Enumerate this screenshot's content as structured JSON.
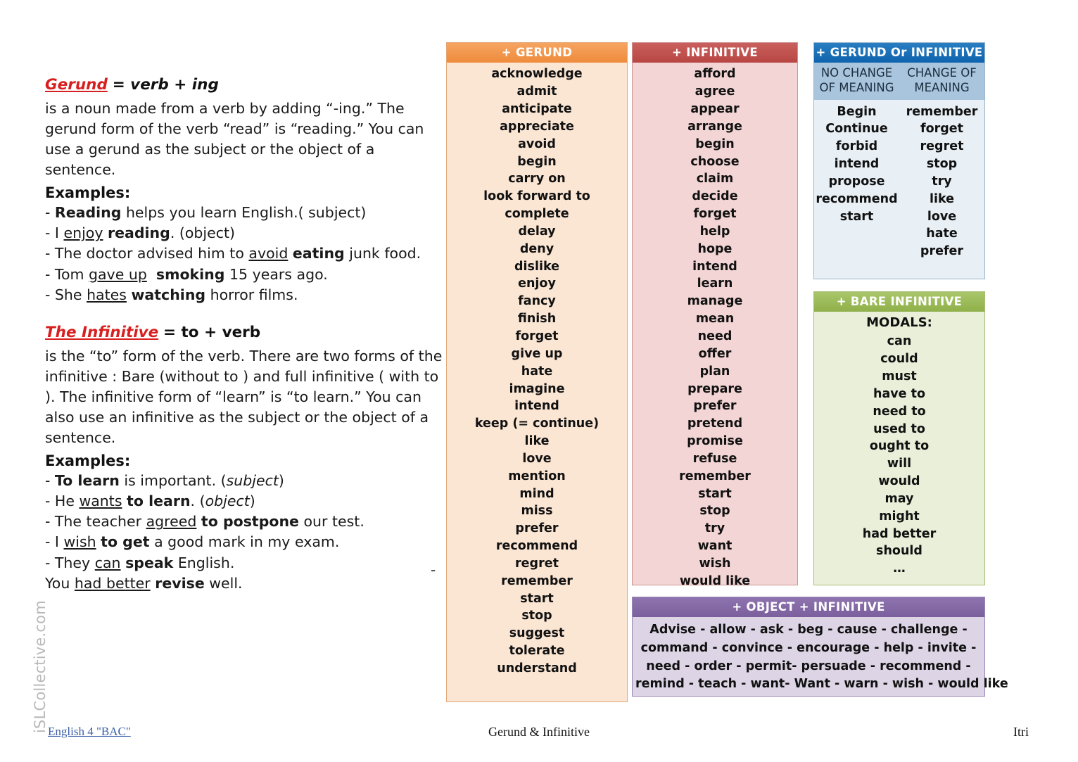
{
  "left": {
    "gerund": {
      "title_kw": "Gerund",
      "title_rest": "= verb + ing",
      "paragraph": "is a noun made from a verb by adding “-ing.” The gerund form of the verb “read” is “reading.” You can use a gerund as the subject or the object of a sentence.",
      "examples_label": "Examples:",
      "examples": [
        "- Reading helps you learn English.( subject)",
        "- I enjoy reading. (object)",
        "- The doctor advised him to avoid eating junk food.",
        "- Tom gave up smoking 15 years ago.",
        "- She hates watching horror films."
      ]
    },
    "infinitive": {
      "title_kw": "The Infinitive",
      "title_rest": "=  to + verb",
      "paragraph": "is the “to” form of the verb. There are two forms of the infinitive : Bare (without to ) and full infinitive ( with to ). The infinitive form of “learn” is “to learn.” You can also use an infinitive as the subject or the object of a sentence.",
      "examples_label": "Examples:",
      "examples": [
        "- To learn is important. (subject)",
        "- He wants to learn. (object)",
        "- The teacher agreed to postpone our test.",
        "- I wish to get a good mark in my exam.",
        "- They can speak English.",
        "You had better revise well."
      ]
    },
    "stray_dash": "-"
  },
  "watermark": "iSLCollective.com",
  "panels": {
    "gerund": {
      "header": "+ GERUND",
      "header_color": "#ef8b3c",
      "body_color": "#fbe6d4",
      "words": [
        "acknowledge",
        "admit",
        "anticipate",
        "appreciate",
        "avoid",
        "begin",
        "carry on",
        "look forward to",
        "complete",
        "delay",
        "deny",
        "dislike",
        "enjoy",
        "fancy",
        "finish",
        "forget",
        "give up",
        "hate",
        "imagine",
        "intend",
        "keep (= continue)",
        "like",
        "love",
        "mention",
        "mind",
        "miss",
        "prefer",
        "recommend",
        "regret",
        "remember",
        "start",
        "stop",
        "suggest",
        "tolerate",
        "understand"
      ]
    },
    "infinitive": {
      "header": "+ INFINITIVE",
      "header_color": "#b84643",
      "body_color": "#f2d5d4",
      "words": [
        "afford",
        "agree",
        "appear",
        "arrange",
        "begin",
        "choose",
        "claim",
        "decide",
        "forget",
        "help",
        "hope",
        "intend",
        "learn",
        "manage",
        "mean",
        "need",
        "offer",
        "plan",
        "prepare",
        "prefer",
        "pretend",
        "promise",
        "refuse",
        "remember",
        "start",
        "stop",
        "try",
        "want",
        "wish",
        "would like"
      ]
    },
    "both": {
      "header": "+ GERUND Or INFINITIVE",
      "header_color": "#0d63ad",
      "subhead_color": "#a9c5de",
      "body_color": "#e8eff5",
      "subhead_left": "NO CHANGE OF MEANING",
      "subhead_right": "CHANGE OF MEANING",
      "left_words": [
        "Begin",
        "Continue",
        "forbid",
        "intend",
        "propose",
        "recommend",
        "start"
      ],
      "right_words": [
        "remember",
        "forget",
        "regret",
        "stop",
        "try",
        "like",
        "love",
        "hate",
        "prefer"
      ]
    },
    "bare": {
      "header": "+ BARE INFINITIVE",
      "header_color": "#8fb049",
      "body_color": "#e9efd9",
      "modals_label": "MODALS:",
      "words": [
        "can",
        "could",
        "must",
        "have to",
        "need to",
        "used to",
        "ought to",
        "will",
        "would",
        "may",
        "might",
        "had better",
        "should",
        "…"
      ]
    },
    "object": {
      "header": "+ OBJECT + INFINITIVE",
      "header_color": "#7a5f9c",
      "body_color": "#ddd5e6",
      "lines": [
        "Advise -  allow -  ask  -  beg  -  cause  -  challenge  -",
        "command  -  convince  -  encourage  -  help -  invite  -",
        "need  -  order  -  permit-  persuade -  recommend -",
        "remind -  teach -  want-  Want -  warn -  wish -  would like"
      ]
    }
  },
  "footer": {
    "left": "English 4 \"BAC\"",
    "center": "Gerund & Infinitive",
    "right": "Itri"
  }
}
